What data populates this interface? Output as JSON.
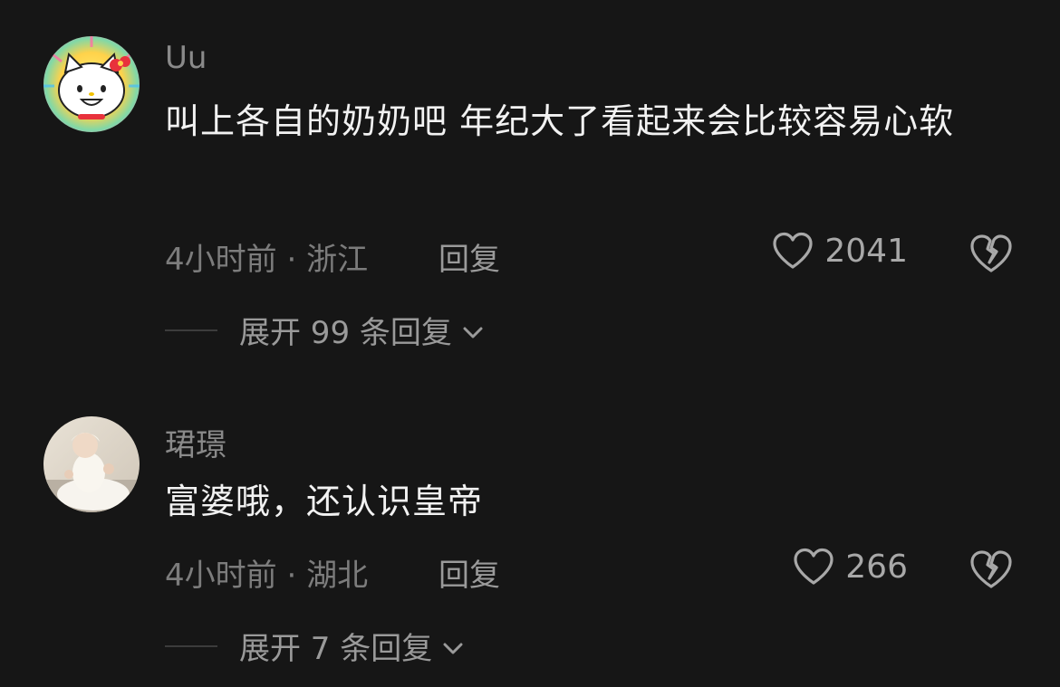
{
  "comments": [
    {
      "username": "Uu",
      "text": "叫上各自的奶奶吧 年纪大了看起来会比较容易心软",
      "time": "4小时前",
      "location": "浙江",
      "reply_label": "回复",
      "likes": "2041",
      "expand_label": "展开 99 条回复",
      "avatar_icon": "hello-kitty-avatar"
    },
    {
      "username": "珺璟",
      "text": "富婆哦，还认识皇帝",
      "time": "4小时前",
      "location": "湖北",
      "reply_label": "回复",
      "likes": "266",
      "expand_label": "展开 7 条回复",
      "avatar_icon": "baby-photo-avatar"
    }
  ],
  "meta_separator": " · ",
  "colors": {
    "background": "#161616",
    "primary_text": "#f2f2f2",
    "secondary_text": "#7c7c7c"
  }
}
